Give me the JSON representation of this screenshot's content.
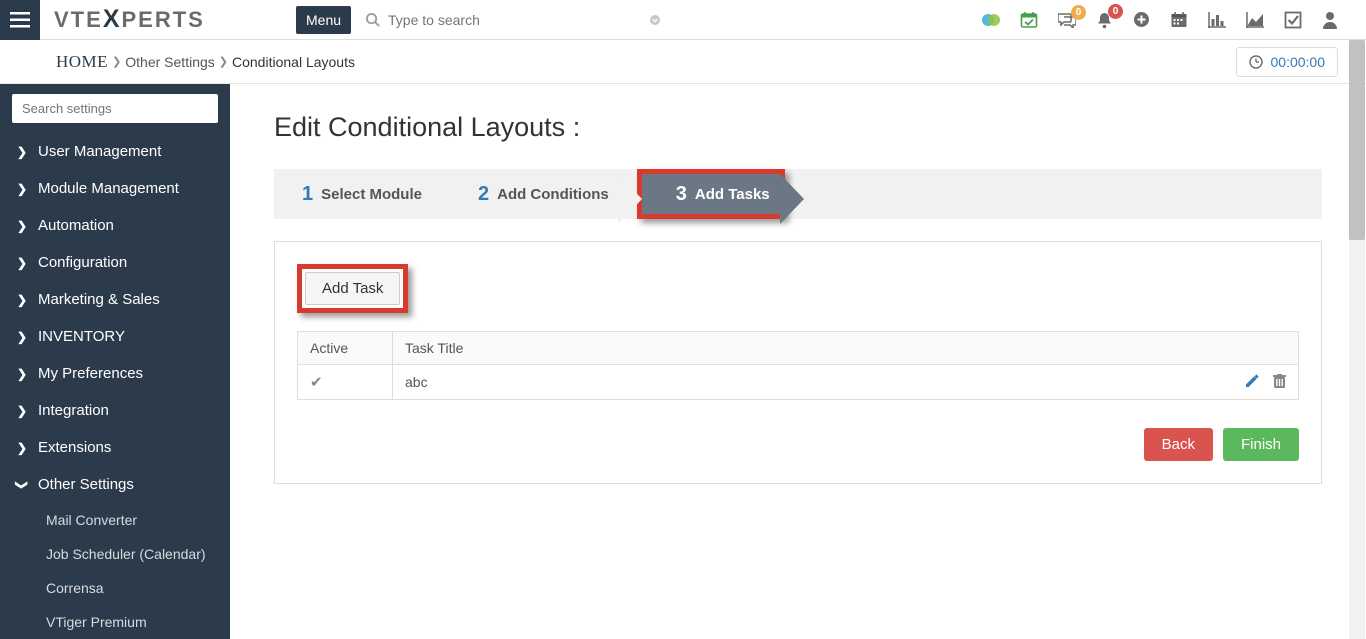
{
  "header": {
    "menu_label": "Menu",
    "search_placeholder": "Type to search",
    "badge_comments": "0",
    "badge_alerts": "0"
  },
  "breadcrumb": {
    "home": "HOME",
    "level1": "Other Settings",
    "level2": "Conditional Layouts",
    "timer": "00:00:00"
  },
  "sidebar": {
    "search_placeholder": "Search settings",
    "items": [
      "User Management",
      "Module Management",
      "Automation",
      "Configuration",
      "Marketing & Sales",
      "INVENTORY",
      "My Preferences",
      "Integration",
      "Extensions",
      "Other Settings"
    ],
    "sub_items": [
      "Mail Converter",
      "Job Scheduler (Calendar)",
      "Corrensa",
      "VTiger Premium"
    ]
  },
  "page": {
    "title": "Edit Conditional Layouts :",
    "steps": {
      "s1_num": "1",
      "s1_label": "Select Module",
      "s2_num": "2",
      "s2_label": "Add Conditions",
      "s3_num": "3",
      "s3_label": "Add Tasks"
    },
    "add_task_label": "Add Task",
    "table": {
      "th_active": "Active",
      "th_title": "Task Title",
      "row1_title": "abc"
    },
    "buttons": {
      "back": "Back",
      "finish": "Finish"
    }
  }
}
